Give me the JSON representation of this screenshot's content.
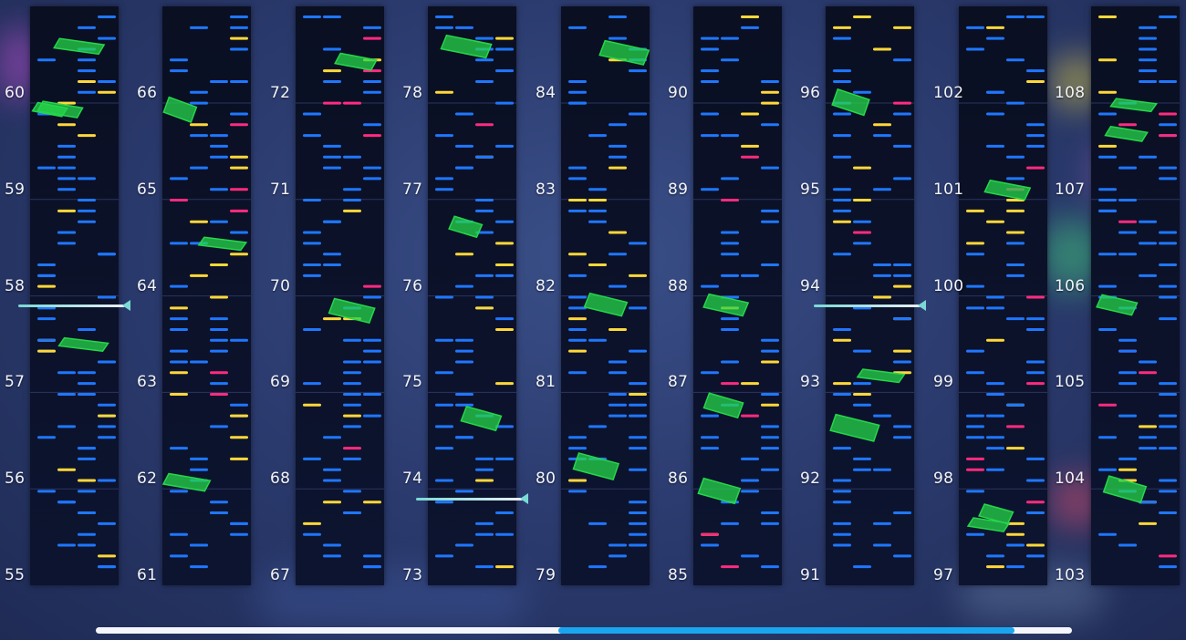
{
  "view": "chart-overview",
  "colors": {
    "tap": "#1f77ff",
    "hold": "#ffd83a",
    "flick": "#ff2b7f",
    "slide": "#26d64a",
    "measure_line": "#2a3560",
    "scroll_thumb": "#1aa6ee",
    "judge_line": "#7ad9d4"
  },
  "columns": [
    {
      "measures": [
        "55",
        "56",
        "57",
        "58",
        "59",
        "60"
      ]
    },
    {
      "measures": [
        "61",
        "62",
        "63",
        "64",
        "65",
        "66"
      ]
    },
    {
      "measures": [
        "67",
        "68",
        "69",
        "70",
        "71",
        "72"
      ]
    },
    {
      "measures": [
        "73",
        "74",
        "75",
        "76",
        "77",
        "78"
      ]
    },
    {
      "measures": [
        "79",
        "80",
        "81",
        "82",
        "83",
        "84"
      ]
    },
    {
      "measures": [
        "85",
        "86",
        "87",
        "88",
        "89",
        "90"
      ]
    },
    {
      "measures": [
        "91",
        "92",
        "93",
        "94",
        "95",
        "96"
      ]
    },
    {
      "measures": [
        "97",
        "98",
        "99",
        "100",
        "101",
        "102"
      ]
    },
    {
      "measures": [
        "103",
        "104",
        "105",
        "106",
        "107",
        "108"
      ]
    }
  ],
  "markers": [
    {
      "column": 0,
      "measure_position": 57.9
    },
    {
      "column": 3,
      "measure_position": 73.9
    },
    {
      "column": 6,
      "measure_position": 93.9
    }
  ],
  "scrollbar": {
    "position_fraction": 0.47,
    "visible_fraction": 0.47
  }
}
